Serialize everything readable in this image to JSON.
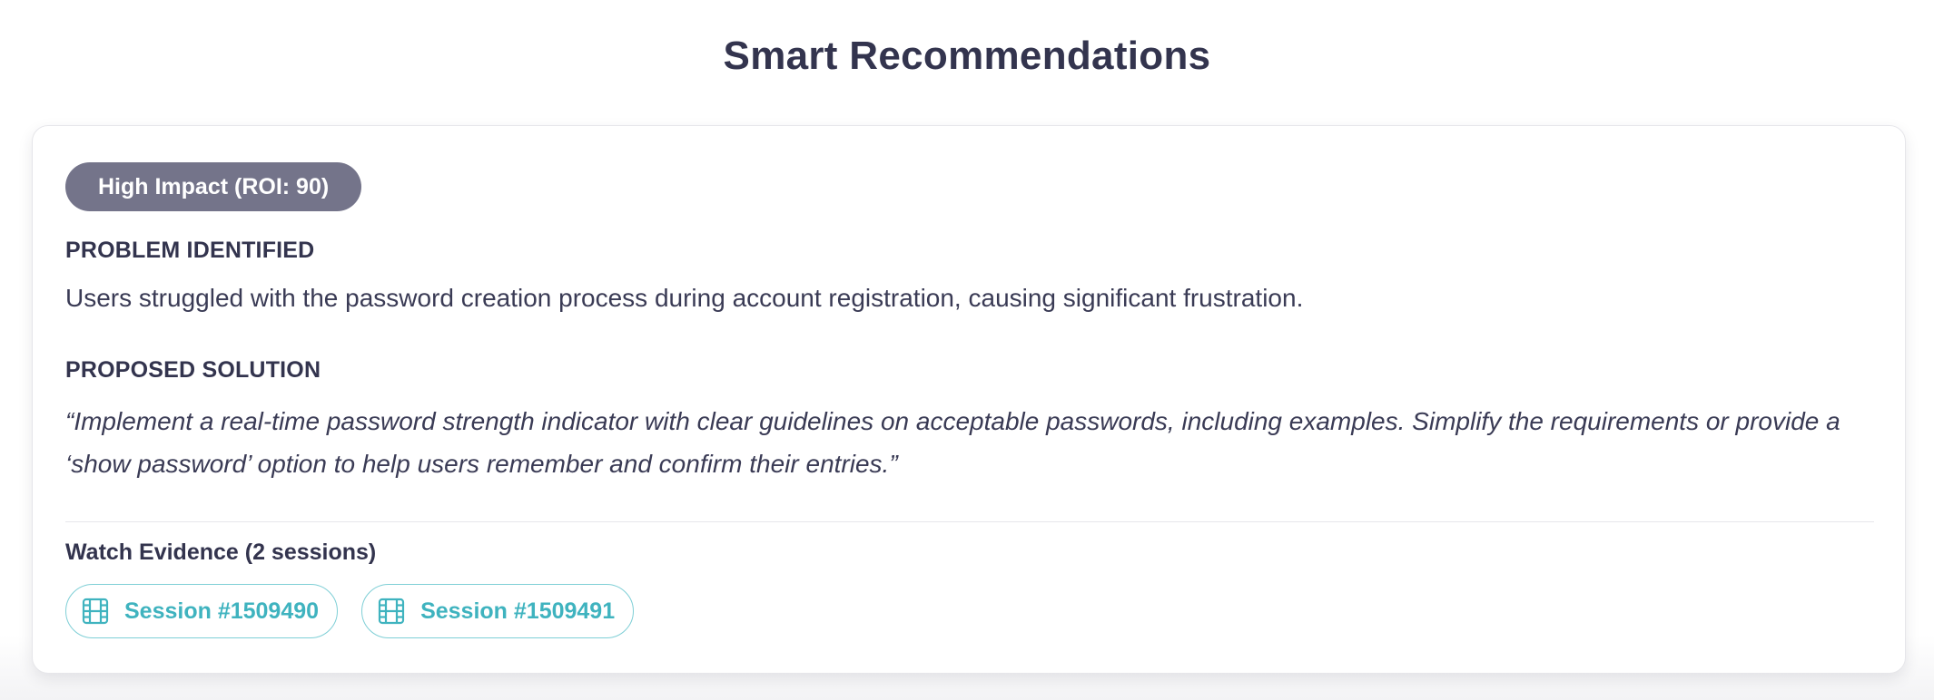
{
  "page": {
    "title": "Smart Recommendations"
  },
  "recommendation": {
    "badge": "High Impact (ROI: 90)",
    "problem_heading": "PROBLEM IDENTIFIED",
    "problem_text": "Users struggled with the password creation process during account registration, causing significant frustration.",
    "solution_heading": "PROPOSED SOLUTION",
    "solution_text": "“Implement a real-time password strength indicator with clear guidelines on acceptable passwords, including examples. Simplify the requirements or provide a ‘show password’ option to help users remember and confirm their entries.”",
    "evidence_label": "Watch Evidence (2 sessions)",
    "sessions": [
      {
        "label": "Session #1509490",
        "icon": "film-icon"
      },
      {
        "label": "Session #1509491",
        "icon": "film-icon"
      }
    ]
  },
  "colors": {
    "badge_bg": "#74748a",
    "accent": "#3fb3bf",
    "text": "#3a3b55"
  }
}
